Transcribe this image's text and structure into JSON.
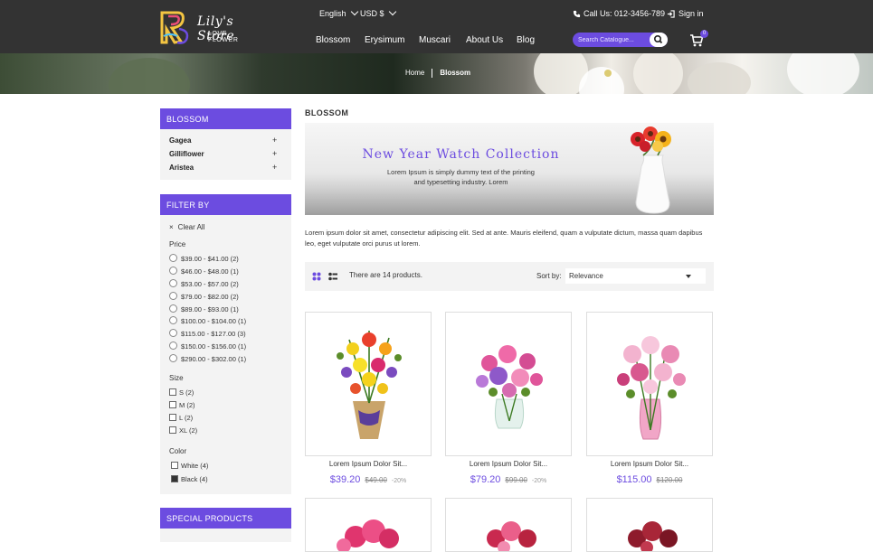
{
  "header": {
    "store_name": "Lily's Store",
    "tagline": "LOVE FLOWER",
    "language": "English",
    "currency": "USD $",
    "call_us": "Call Us: 012-3456-789",
    "sign_in": "Sign in",
    "nav": [
      "Blossom",
      "Erysimum",
      "Muscari",
      "About Us",
      "Blog"
    ],
    "search_placeholder": "Search Catalogue...",
    "cart_count": "0"
  },
  "breadcrumb": {
    "home": "Home",
    "current": "Blossom"
  },
  "sidebar": {
    "category_title": "BLOSSOM",
    "categories": [
      "Gagea",
      "Gilliflower",
      "Aristea"
    ],
    "filter_title": "FILTER BY",
    "clear_all": "Clear All",
    "price_label": "Price",
    "prices": [
      "$39.00 - $41.00 (2)",
      "$46.00 - $48.00 (1)",
      "$53.00 - $57.00 (2)",
      "$79.00 - $82.00 (2)",
      "$89.00 - $93.00 (1)",
      "$100.00 - $104.00 (1)",
      "$115.00 - $127.00 (3)",
      "$150.00 - $156.00 (1)",
      "$290.00 - $302.00 (1)"
    ],
    "size_label": "Size",
    "sizes": [
      "S (2)",
      "M (2)",
      "L (2)",
      "XL (2)"
    ],
    "color_label": "Color",
    "colors": [
      {
        "label": "White (4)",
        "swatch": "#ffffff"
      },
      {
        "label": "Black (4)",
        "swatch": "#333333"
      }
    ],
    "special_title": "SPECIAL PRODUCTS"
  },
  "main": {
    "title": "BLOSSOM",
    "promo_title": "New Year Watch Collection",
    "promo_text": "Lorem Ipsum is simply dummy text of the printing and typesetting industry. Lorem",
    "description": "Lorem ipsum dolor sit amet, consectetur adipiscing elit. Sed at ante. Mauris eleifend, quam a vulputate dictum, massa quam dapibus leo, eget vulputate orci purus ut lorem.",
    "product_count": "There are 14 products.",
    "sort_label": "Sort by:",
    "sort_value": "Relevance"
  },
  "products": [
    {
      "name": "Lorem Ipsum Dolor Sit...",
      "price": "$39.20",
      "old_price": "$49.00",
      "discount": "-20%"
    },
    {
      "name": "Lorem Ipsum Dolor Sit...",
      "price": "$79.20",
      "old_price": "$99.00",
      "discount": "-20%"
    },
    {
      "name": "Lorem Ipsum Dolor Sit...",
      "price": "$115.00",
      "old_price": "$120.00",
      "discount": ""
    }
  ],
  "colors": {
    "accent": "#6c4ce0",
    "topbar": "#333333",
    "panel": "#f3f3f3"
  }
}
